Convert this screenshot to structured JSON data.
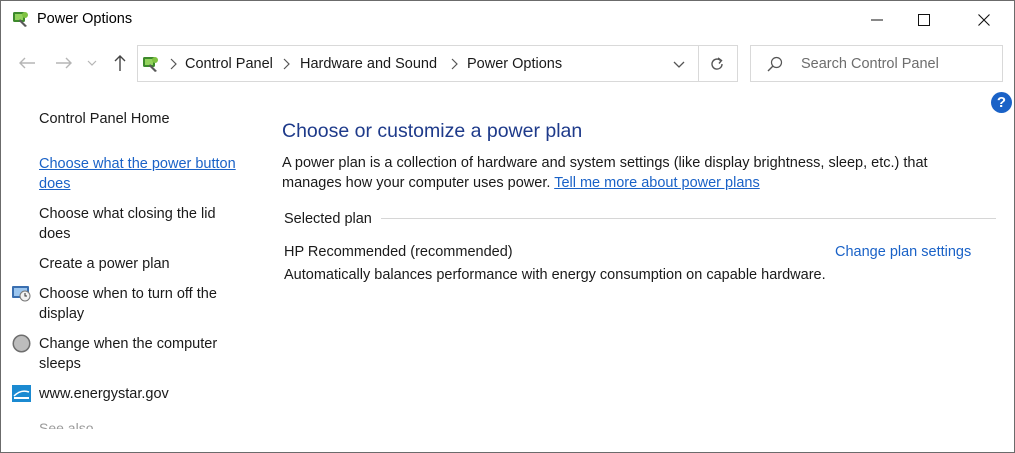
{
  "window": {
    "title": "Power Options",
    "icon": "power-options-icon"
  },
  "nav": {
    "back": "back-arrow-icon",
    "forward": "forward-arrow-icon",
    "recent": "chevron-down-icon",
    "up": "up-arrow-icon"
  },
  "address": {
    "crumbs": [
      "Control Panel",
      "Hardware and Sound",
      "Power Options"
    ],
    "refresh": "refresh-icon"
  },
  "search": {
    "placeholder": "Search Control Panel"
  },
  "sidebar": {
    "home": "Control Panel Home",
    "links": [
      {
        "line1": "Choose what the power button",
        "line2": "does",
        "icon": ""
      },
      {
        "line1": "Choose what closing the lid",
        "line2": "does",
        "icon": ""
      },
      {
        "line1": "Create a power plan",
        "line2": "",
        "icon": ""
      },
      {
        "line1": "Choose when to turn off the",
        "line2": "display",
        "icon": "display-clock-icon"
      },
      {
        "line1": "Change when the computer",
        "line2": "sleeps",
        "icon": "moon-sleep-icon"
      },
      {
        "line1": "www.energystar.gov",
        "line2": "",
        "icon": "energystar-icon"
      }
    ]
  },
  "main": {
    "heading": "Choose or customize a power plan",
    "description": "A power plan is a collection of hardware and system settings (like display brightness, sleep, etc.) that manages how your computer uses power.",
    "more_link": "Tell me more about power plans",
    "selected_label": "Selected plan",
    "plan_name": "HP Recommended (recommended)",
    "plan_description": "Automatically balances performance with energy consumption on capable hardware.",
    "change_link": "Change plan settings"
  },
  "colors": {
    "link": "#1a62c7",
    "heading": "#1e3a8a",
    "help_badge": "#1a62c7"
  }
}
